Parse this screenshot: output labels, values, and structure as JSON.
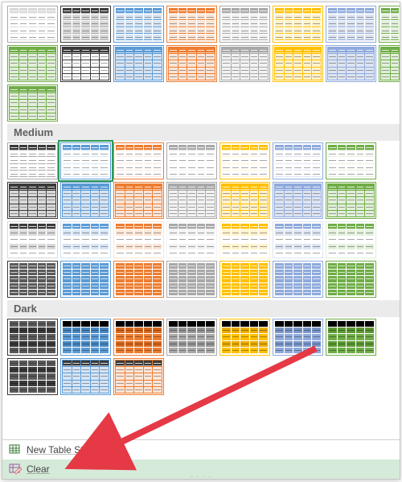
{
  "colors": {
    "black": "#3a3a3a",
    "darkgray": "#5a5a5a",
    "gray": "#a9a9a9",
    "ltgray": "#d9d9d9",
    "blue": "#5b9bd5",
    "ltblue": "#d6e4f4",
    "orange": "#ed7d31",
    "ltorange": "#fbe5d6",
    "white": "#ffffff",
    "yellow": "#ffc000",
    "ltyellow": "#fff2cc",
    "lightblue2": "#8faadc",
    "ltlightblue2": "#dde4f1",
    "green": "#70ad47",
    "ltgreen": "#e2efda",
    "vltgray": "#f2f2f2"
  },
  "sections": [
    {
      "label": null,
      "rows": [
        [
          {
            "header": "ltgray",
            "band": "white",
            "border": "gray",
            "sep": "ltgray"
          },
          {
            "header": "black",
            "band": "ltgray",
            "border": "black",
            "sep": "gray"
          },
          {
            "header": "blue",
            "band": "ltblue",
            "border": "blue",
            "sep": "blue"
          },
          {
            "header": "orange",
            "band": "ltorange",
            "border": "orange",
            "sep": "orange"
          },
          {
            "header": "gray",
            "band": "vltgray",
            "border": "gray",
            "sep": "gray"
          },
          {
            "header": "yellow",
            "band": "ltyellow",
            "border": "yellow",
            "sep": "yellow"
          },
          {
            "header": "lightblue2",
            "band": "ltlightblue2",
            "border": "lightblue2",
            "sep": "lightblue2"
          },
          {
            "header": "green",
            "band": "ltgreen",
            "border": "green",
            "sep": "green"
          }
        ],
        [
          {
            "header": "green",
            "band": "ltgreen",
            "border": "green",
            "grid": true
          },
          {
            "header": "black",
            "band": "white",
            "border": "black",
            "grid": true
          },
          {
            "header": "blue",
            "band": "ltblue",
            "border": "blue",
            "grid": true
          },
          {
            "header": "orange",
            "band": "ltorange",
            "border": "orange",
            "grid": true
          },
          {
            "header": "gray",
            "band": "vltgray",
            "border": "gray",
            "grid": true
          },
          {
            "header": "yellow",
            "band": "ltyellow",
            "border": "yellow",
            "grid": true
          },
          {
            "header": "lightblue2",
            "band": "ltlightblue2",
            "border": "lightblue2",
            "grid": true
          },
          {
            "header": "green",
            "band": "ltgreen",
            "border": "green",
            "grid": true
          }
        ],
        [
          {
            "header": "green",
            "band": "ltgreen",
            "border": "green",
            "grid": true
          }
        ]
      ]
    },
    {
      "label": "Medium",
      "rows": [
        [
          {
            "header": "black",
            "band": "white",
            "border": "gray",
            "sep": "gray"
          },
          {
            "header": "blue",
            "band": "white",
            "border": "blue",
            "sep": "ltblue",
            "selected": true
          },
          {
            "header": "orange",
            "band": "white",
            "border": "orange",
            "sep": "ltorange"
          },
          {
            "header": "gray",
            "band": "white",
            "border": "gray",
            "sep": "vltgray"
          },
          {
            "header": "yellow",
            "band": "white",
            "border": "yellow",
            "sep": "ltyellow"
          },
          {
            "header": "lightblue2",
            "band": "white",
            "border": "lightblue2",
            "sep": "ltlightblue2"
          },
          {
            "header": "green",
            "band": "white",
            "border": "green",
            "sep": "ltgreen"
          }
        ],
        [
          {
            "header": "black",
            "band": "ltgray",
            "border": "black",
            "grid": true
          },
          {
            "header": "blue",
            "band": "ltblue",
            "border": "blue",
            "grid": true
          },
          {
            "header": "orange",
            "band": "ltorange",
            "border": "orange",
            "grid": true
          },
          {
            "header": "gray",
            "band": "vltgray",
            "border": "gray",
            "grid": true
          },
          {
            "header": "yellow",
            "band": "ltyellow",
            "border": "yellow",
            "grid": true
          },
          {
            "header": "lightblue2",
            "band": "ltlightblue2",
            "border": "lightblue2",
            "grid": true
          },
          {
            "header": "green",
            "band": "ltgreen",
            "border": "green",
            "grid": true
          }
        ],
        [
          {
            "header": "black",
            "band": "white",
            "alt": "ltgray",
            "border": "ltgray"
          },
          {
            "header": "blue",
            "band": "white",
            "alt": "ltblue",
            "border": "ltblue"
          },
          {
            "header": "orange",
            "band": "white",
            "alt": "ltorange",
            "border": "ltorange"
          },
          {
            "header": "gray",
            "band": "white",
            "alt": "vltgray",
            "border": "vltgray"
          },
          {
            "header": "yellow",
            "band": "white",
            "alt": "ltyellow",
            "border": "ltyellow"
          },
          {
            "header": "lightblue2",
            "band": "white",
            "alt": "ltlightblue2",
            "border": "ltlightblue2"
          },
          {
            "header": "green",
            "band": "white",
            "alt": "ltgreen",
            "border": "ltgreen"
          }
        ],
        [
          {
            "solid": "darkgray",
            "border": "black"
          },
          {
            "solid": "blue",
            "border": "blue"
          },
          {
            "solid": "orange",
            "border": "orange"
          },
          {
            "solid": "gray",
            "border": "gray"
          },
          {
            "solid": "yellow",
            "border": "yellow"
          },
          {
            "solid": "lightblue2",
            "border": "lightblue2"
          },
          {
            "solid": "green",
            "border": "green"
          }
        ]
      ]
    },
    {
      "label": "Dark",
      "rows": [
        [
          {
            "solid": "darkgray",
            "alt": "black",
            "border": "black"
          },
          {
            "solid": "blue",
            "alt": "ltblue",
            "dark": true,
            "border": "blue"
          },
          {
            "solid": "orange",
            "alt": "ltorange",
            "dark": true,
            "border": "orange"
          },
          {
            "solid": "gray",
            "alt": "vltgray",
            "dark": true,
            "border": "gray"
          },
          {
            "solid": "yellow",
            "alt": "ltyellow",
            "dark": true,
            "border": "yellow"
          },
          {
            "solid": "lightblue2",
            "alt": "ltlightblue2",
            "dark": true,
            "border": "lightblue2"
          },
          {
            "solid": "green",
            "alt": "ltgreen",
            "dark": true,
            "border": "green"
          }
        ],
        [
          {
            "solid": "darkgray",
            "alt": "black",
            "border": "black"
          },
          {
            "header": "black",
            "band": "ltblue",
            "border": "blue",
            "grid": true
          },
          {
            "header": "black",
            "band": "ltorange",
            "border": "orange",
            "grid": true
          }
        ]
      ]
    }
  ],
  "footer": {
    "new_style_label": "New Table Style...",
    "clear_label": "Clear"
  }
}
